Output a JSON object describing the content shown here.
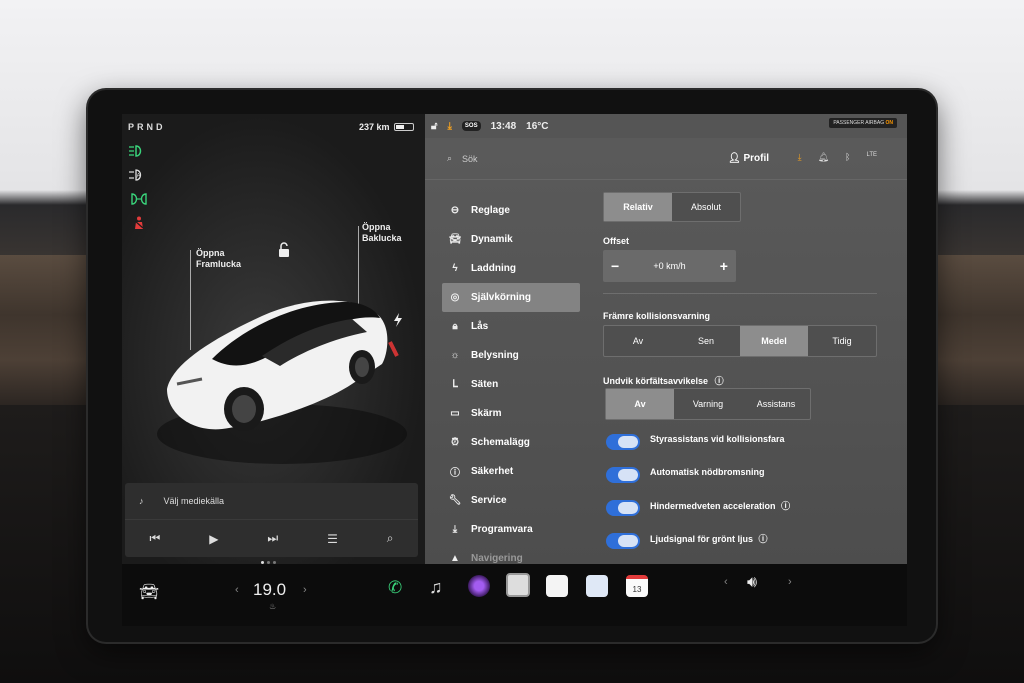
{
  "left_panel": {
    "gear": "PRND",
    "range": "237 km",
    "front_trunk_label": "Öppna Framlucka",
    "rear_trunk_label": "Öppna Baklucka",
    "media": {
      "source_label": "Välj mediekälla"
    }
  },
  "status_bar": {
    "sos": "SOS",
    "time": "13:48",
    "temperature": "16°C",
    "airbag_text": "PASSENGER AIRBAG",
    "airbag_state": "ON"
  },
  "header": {
    "search_placeholder": "Sök",
    "profile_label": "Profil",
    "signal": "LTE"
  },
  "menu": {
    "items": [
      {
        "label": "Reglage",
        "icon": "toggle-icon"
      },
      {
        "label": "Dynamik",
        "icon": "car-icon"
      },
      {
        "label": "Laddning",
        "icon": "bolt-icon"
      },
      {
        "label": "Självkörning",
        "icon": "steering-wheel-icon",
        "selected": true
      },
      {
        "label": "Lås",
        "icon": "lock-icon"
      },
      {
        "label": "Belysning",
        "icon": "sun-icon"
      },
      {
        "label": "Säten",
        "icon": "seat-icon"
      },
      {
        "label": "Skärm",
        "icon": "display-icon"
      },
      {
        "label": "Schemalägg",
        "icon": "alarm-clock-icon"
      },
      {
        "label": "Säkerhet",
        "icon": "info-icon"
      },
      {
        "label": "Service",
        "icon": "wrench-icon"
      },
      {
        "label": "Programvara",
        "icon": "download-icon"
      },
      {
        "label": "Navigering",
        "icon": "navigation-icon"
      }
    ]
  },
  "settings": {
    "offset_mode": {
      "options": [
        "Relativ",
        "Absolut"
      ],
      "selected": "Relativ"
    },
    "offset": {
      "title": "Offset",
      "minus": "−",
      "value": "+0 km/h",
      "plus": "+"
    },
    "collision_warning": {
      "title": "Främre kollisionsvarning",
      "options": [
        "Av",
        "Sen",
        "Medel",
        "Tidig"
      ],
      "selected": "Medel"
    },
    "lane_departure": {
      "title": "Undvik körfältsavvikelse",
      "options": [
        "Av",
        "Varning",
        "Assistans"
      ],
      "selected": "Av"
    },
    "toggles": [
      {
        "label": "Styrassistans vid kollisionsfara",
        "on": true
      },
      {
        "label": "Automatisk nödbromsning",
        "on": true
      },
      {
        "label": "Hindermedveten acceleration",
        "on": true,
        "info": true
      },
      {
        "label": "Ljudsignal för grönt ljus",
        "on": true,
        "info": true
      }
    ]
  },
  "taskbar": {
    "cabin_temp": "19.0",
    "calendar_day": "13"
  },
  "colors": {
    "toggle_on": "#2f6fd9",
    "warning_red": "#e23b3b",
    "light_green": "#39d27a",
    "download_orange": "#f0a020"
  }
}
